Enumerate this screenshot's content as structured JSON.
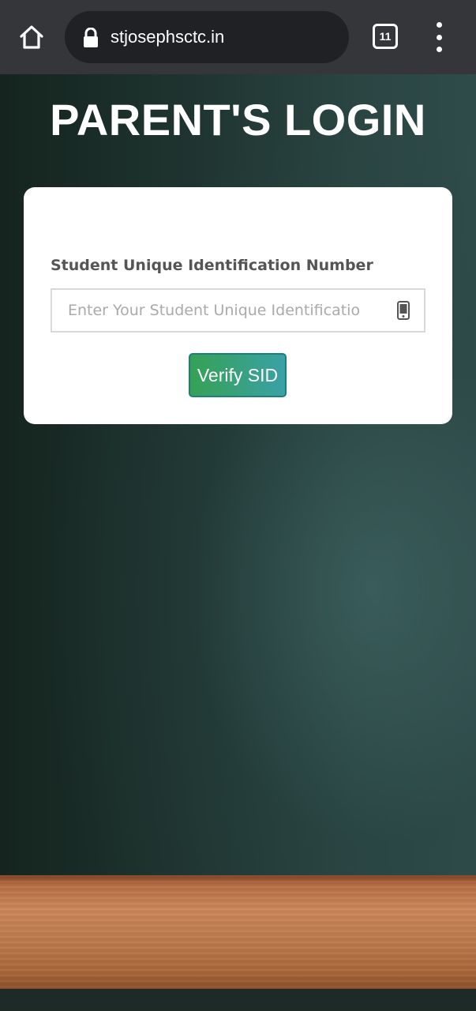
{
  "browser": {
    "url": "stjosephsctc.in",
    "tab_count": "11",
    "icons": {
      "home": "home-icon",
      "lock": "lock-icon",
      "tabs": "tab-switcher-icon",
      "menu": "more-vertical-icon"
    }
  },
  "page": {
    "title": "PARENT'S LOGIN",
    "form": {
      "field_label": "Student Unique Identification Number",
      "input_placeholder": "Enter Your Student Unique Identificatio",
      "input_value": "",
      "input_icon": "mobile-phone-icon",
      "submit_label": "Verify SID"
    }
  },
  "colors": {
    "chrome_bg": "#35363a",
    "url_bar_bg": "#202124",
    "button_gradient_start": "#36a154",
    "button_gradient_end": "#3aa1a6",
    "label_text": "#555555",
    "board_green": "#1f3430",
    "wood_brown": "#c98557"
  }
}
